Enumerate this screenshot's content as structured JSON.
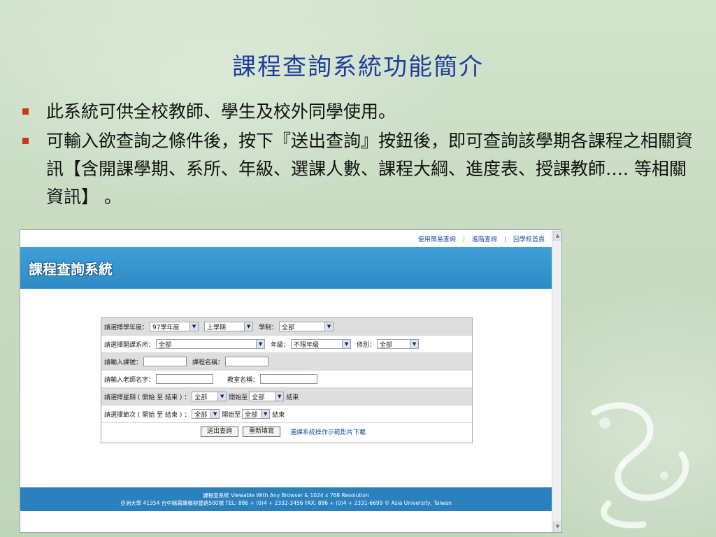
{
  "slide": {
    "title": "課程查詢系統功能簡介",
    "bullets": [
      "此系統可供全校教師、學生及校外同學使用。",
      "可輸入欲查詢之條件後，按下『送出查詢』按鈕後，即可查詢該學期各課程之相關資訊【含開課學期、系所、年級、選課人數、課程大綱、進度表、授課教師…. 等相關資訊】 。"
    ]
  },
  "screenshot": {
    "top_links": [
      "使用簡易查詢",
      "進階查詢",
      "回學校首頁"
    ],
    "banner_title": "課程查詢系統",
    "form": {
      "row1": {
        "year_label": "請選擇學年度：",
        "year_value": "97學年度",
        "term_value": "上學期",
        "system_label": "學制：",
        "system_value": "全部"
      },
      "row2": {
        "dept_label": "請選擇開課系所：",
        "dept_value": "全部",
        "grade_label": "年級：",
        "grade_value": "不限年級",
        "type_label": "修別：",
        "type_value": "全部"
      },
      "row3": {
        "course_no_label": "請輸入課號：",
        "course_name_label": "課程名稱："
      },
      "row4": {
        "teacher_label": "請輸入老師名字：",
        "room_label": "教室名稱："
      },
      "row5": {
        "weekday_label": "請選擇星期 ( 開始 至 結束 ) ：",
        "weekday_start": "全部",
        "start_to": "開始至",
        "weekday_end": "全部",
        "end_label": "結束"
      },
      "row6": {
        "period_label": "請選擇節次 ( 開始 至 結束 ) ：",
        "period_start": "全部",
        "start_to": "開始至",
        "period_end": "全部",
        "end_label": "結束"
      },
      "buttons": {
        "submit": "送出查詢",
        "reset": "重新填寫",
        "tutorial_link": "選課系統操作示範影片下載"
      }
    },
    "footer": {
      "line1": "課程查系統 Viewable With Any Browser & 1024 x 768 Resolution",
      "line2": "亞洲大學 41354 台中縣霧峰鄉柳豐路500號 TEL: 886 + (0)4 + 2332-3456 FAX: 886 + (0)4 + 2331-6699 © Asia University, Taiwan"
    }
  }
}
